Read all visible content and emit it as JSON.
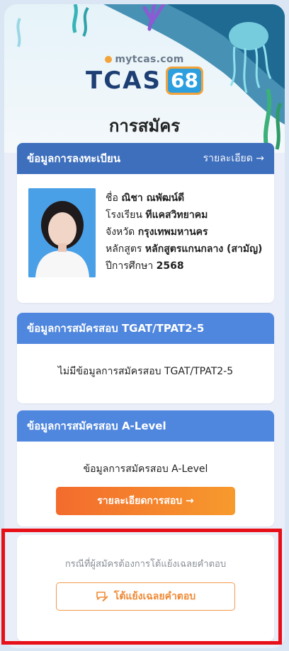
{
  "header": {
    "site": "mytcas.com",
    "brand": "TCAS",
    "brand_number": "68",
    "page_title": "การสมัคร"
  },
  "registration": {
    "heading": "ข้อมูลการลงทะเบียน",
    "details_link": "รายละเอียด →",
    "name_label": "ชื่อ",
    "name_value": "ณิชา ณพัฒน์ดี",
    "school_label": "โรงเรียน",
    "school_value": "ทีแคสวิทยาคม",
    "province_label": "จังหวัด",
    "province_value": "กรุงเทพมหานคร",
    "curriculum_label": "หลักสูตร",
    "curriculum_value": "หลักสูตรแกนกลาง (สามัญ)",
    "year_label": "ปีการศึกษา",
    "year_value": "2568"
  },
  "tgat": {
    "heading": "ข้อมูลการสมัครสอบ TGAT/TPAT2-5",
    "message": "ไม่มีข้อมูลการสมัครสอบ TGAT/TPAT2-5"
  },
  "alevel": {
    "heading": "ข้อมูลการสมัครสอบ A-Level",
    "message": "ข้อมูลการสมัครสอบ A-Level",
    "button_label": "รายละเอียดการสอบ →"
  },
  "appeal": {
    "note": "กรณีที่ผู้สมัครต้องการโต้แย้งเฉลยคำตอบ",
    "button_label": "โต้แย้งเฉลยคำตอบ",
    "button_icon": "chat-edit-icon"
  },
  "colors": {
    "header_blue": "#4f86de",
    "orange": "#f36b2d",
    "highlight_red": "#e81018"
  }
}
